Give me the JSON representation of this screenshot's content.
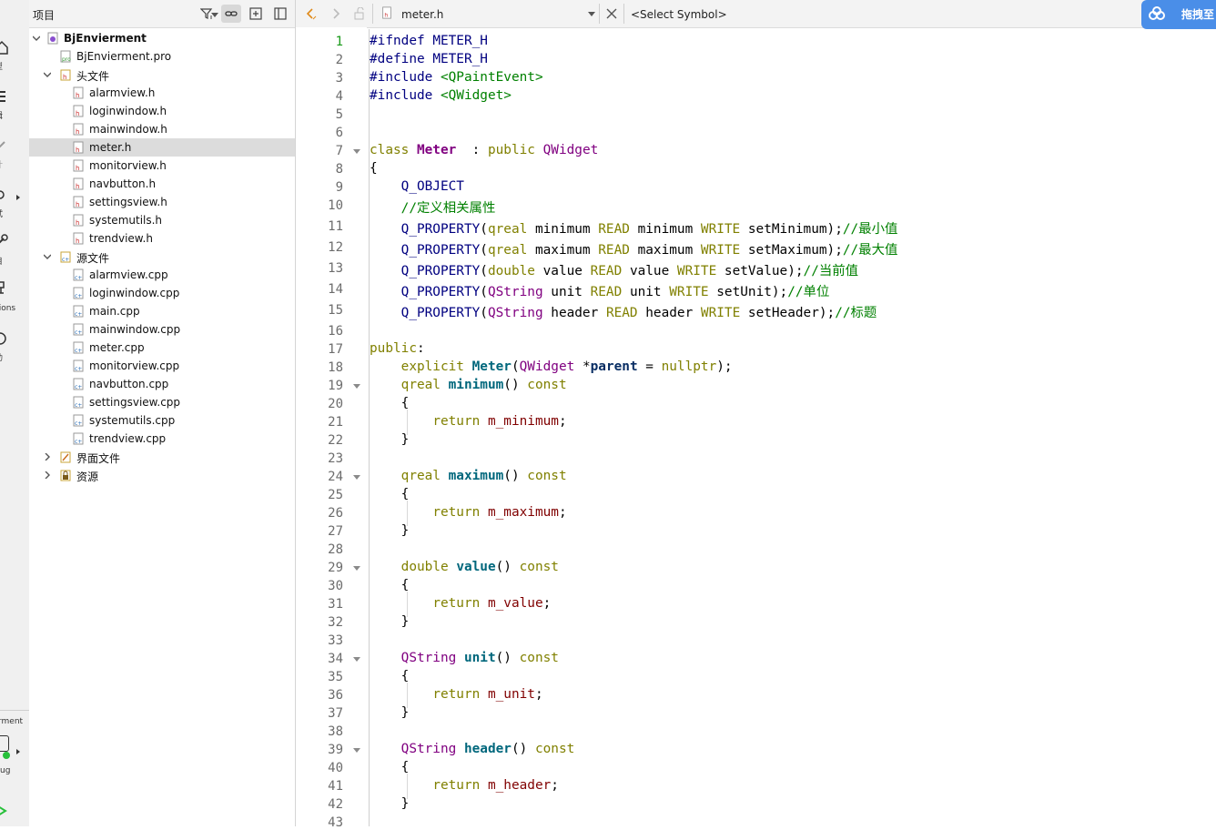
{
  "mode_bar": {
    "items": [
      {
        "label": "型"
      },
      {
        "label": "辑"
      },
      {
        "label": "计"
      },
      {
        "label": "试"
      },
      {
        "label": "目"
      },
      {
        "label": "sions"
      },
      {
        "label": "助"
      }
    ],
    "kit": {
      "project": "rment",
      "config": "ug"
    }
  },
  "project_panel": {
    "view_combo": "项目",
    "tree": {
      "root": "BjEnvierment",
      "pro_file": "BjEnvierment.pro",
      "headers_folder": "头文件",
      "headers": [
        "alarmview.h",
        "loginwindow.h",
        "mainwindow.h",
        "meter.h",
        "monitorview.h",
        "navbutton.h",
        "settingsview.h",
        "systemutils.h",
        "trendview.h"
      ],
      "sources_folder": "源文件",
      "sources": [
        "alarmview.cpp",
        "loginwindow.cpp",
        "main.cpp",
        "mainwindow.cpp",
        "meter.cpp",
        "monitorview.cpp",
        "navbutton.cpp",
        "settingsview.cpp",
        "systemutils.cpp",
        "trendview.cpp"
      ],
      "forms_folder": "界面文件",
      "resources_folder": "资源",
      "selected": "meter.h"
    }
  },
  "editor": {
    "file_name": "meter.h",
    "symbol": "<Select Symbol>",
    "current_line": 1,
    "cloud_label": "拖拽至",
    "line_numbers": [
      "1",
      "2",
      "3",
      "4",
      "5",
      "6",
      "7",
      "8",
      "9",
      "10",
      "11",
      "12",
      "13",
      "14",
      "15",
      "16",
      "17",
      "18",
      "19",
      "20",
      "21",
      "22",
      "23",
      "24",
      "25",
      "26",
      "27",
      "28",
      "29",
      "30",
      "31",
      "32",
      "33",
      "34",
      "35",
      "36",
      "37",
      "38",
      "39",
      "40",
      "41",
      "42",
      "43"
    ],
    "fold_lines": [
      7,
      19,
      24,
      29,
      34,
      39
    ],
    "code": [
      [
        [
          "pp",
          "#ifndef "
        ],
        [
          "mac",
          "METER_H"
        ]
      ],
      [
        [
          "pp",
          "#define "
        ],
        [
          "mac",
          "METER_H"
        ]
      ],
      [
        [
          "pp",
          "#include "
        ],
        [
          "str",
          "<QPaintEvent>"
        ]
      ],
      [
        [
          "pp",
          "#include "
        ],
        [
          "str",
          "<QWidget>"
        ]
      ],
      [],
      [],
      [
        [
          "kw",
          "class "
        ],
        [
          "cls",
          "Meter"
        ],
        [
          "",
          "  : "
        ],
        [
          "kw",
          "public "
        ],
        [
          "ty",
          "QWidget"
        ]
      ],
      [
        [
          "",
          "{"
        ]
      ],
      [
        [
          "",
          "    "
        ],
        [
          "mac",
          "Q_OBJECT"
        ]
      ],
      [
        [
          "",
          "    "
        ],
        [
          "cm",
          "//定义相关属性"
        ]
      ],
      [
        [
          "",
          "    "
        ],
        [
          "mac",
          "Q_PROPERTY"
        ],
        [
          "",
          "("
        ],
        [
          "kw",
          "qreal "
        ],
        [
          "",
          "minimum "
        ],
        [
          "kw",
          "READ "
        ],
        [
          "",
          "minimum "
        ],
        [
          "kw",
          "WRITE "
        ],
        [
          "",
          "setMinimum);"
        ],
        [
          "cm",
          "//最小值"
        ]
      ],
      [
        [
          "",
          "    "
        ],
        [
          "mac",
          "Q_PROPERTY"
        ],
        [
          "",
          "("
        ],
        [
          "kw",
          "qreal "
        ],
        [
          "",
          "maximum "
        ],
        [
          "kw",
          "READ "
        ],
        [
          "",
          "maximum "
        ],
        [
          "kw",
          "WRITE "
        ],
        [
          "",
          "setMaximum);"
        ],
        [
          "cm",
          "//最大值"
        ]
      ],
      [
        [
          "",
          "    "
        ],
        [
          "mac",
          "Q_PROPERTY"
        ],
        [
          "",
          "("
        ],
        [
          "kw",
          "double "
        ],
        [
          "",
          "value "
        ],
        [
          "kw",
          "READ "
        ],
        [
          "",
          "value "
        ],
        [
          "kw",
          "WRITE "
        ],
        [
          "",
          "setValue);"
        ],
        [
          "cm",
          "//当前值"
        ]
      ],
      [
        [
          "",
          "    "
        ],
        [
          "mac",
          "Q_PROPERTY"
        ],
        [
          "",
          "("
        ],
        [
          "ty",
          "QString "
        ],
        [
          "",
          "unit "
        ],
        [
          "kw",
          "READ "
        ],
        [
          "",
          "unit "
        ],
        [
          "kw",
          "WRITE "
        ],
        [
          "",
          "setUnit);"
        ],
        [
          "cm",
          "//单位"
        ]
      ],
      [
        [
          "",
          "    "
        ],
        [
          "mac",
          "Q_PROPERTY"
        ],
        [
          "",
          "("
        ],
        [
          "ty",
          "QString "
        ],
        [
          "",
          "header "
        ],
        [
          "kw",
          "READ "
        ],
        [
          "",
          "header "
        ],
        [
          "kw",
          "WRITE "
        ],
        [
          "",
          "setHeader);"
        ],
        [
          "cm",
          "//标题"
        ]
      ],
      [],
      [
        [
          "kw",
          "public"
        ],
        [
          "",
          ":"
        ]
      ],
      [
        [
          "",
          "    "
        ],
        [
          "kw",
          "explicit "
        ],
        [
          "fn",
          "Meter"
        ],
        [
          "",
          "("
        ],
        [
          "ty",
          "QWidget "
        ],
        [
          "",
          "*"
        ],
        [
          "arg",
          "parent"
        ],
        [
          "",
          " = "
        ],
        [
          "np",
          "nullptr"
        ],
        [
          "",
          ");"
        ]
      ],
      [
        [
          "",
          "    "
        ],
        [
          "kw",
          "qreal "
        ],
        [
          "fn",
          "minimum"
        ],
        [
          "",
          "() "
        ],
        [
          "kw",
          "const"
        ]
      ],
      [
        [
          "",
          "    {"
        ]
      ],
      [
        [
          "",
          "        "
        ],
        [
          "kw",
          "return "
        ],
        [
          "mem",
          "m_minimum"
        ],
        [
          "",
          ";"
        ]
      ],
      [
        [
          "",
          "    }"
        ]
      ],
      [],
      [
        [
          "",
          "    "
        ],
        [
          "kw",
          "qreal "
        ],
        [
          "fn",
          "maximum"
        ],
        [
          "",
          "() "
        ],
        [
          "kw",
          "const"
        ]
      ],
      [
        [
          "",
          "    {"
        ]
      ],
      [
        [
          "",
          "        "
        ],
        [
          "kw",
          "return "
        ],
        [
          "mem",
          "m_maximum"
        ],
        [
          "",
          ";"
        ]
      ],
      [
        [
          "",
          "    }"
        ]
      ],
      [],
      [
        [
          "",
          "    "
        ],
        [
          "kw",
          "double "
        ],
        [
          "fn",
          "value"
        ],
        [
          "",
          "() "
        ],
        [
          "kw",
          "const"
        ]
      ],
      [
        [
          "",
          "    {"
        ]
      ],
      [
        [
          "",
          "        "
        ],
        [
          "kw",
          "return "
        ],
        [
          "mem",
          "m_value"
        ],
        [
          "",
          ";"
        ]
      ],
      [
        [
          "",
          "    }"
        ]
      ],
      [],
      [
        [
          "",
          "    "
        ],
        [
          "ty",
          "QString "
        ],
        [
          "fn",
          "unit"
        ],
        [
          "",
          "() "
        ],
        [
          "kw",
          "const"
        ]
      ],
      [
        [
          "",
          "    {"
        ]
      ],
      [
        [
          "",
          "        "
        ],
        [
          "kw",
          "return "
        ],
        [
          "mem",
          "m_unit"
        ],
        [
          "",
          ";"
        ]
      ],
      [
        [
          "",
          "    }"
        ]
      ],
      [],
      [
        [
          "",
          "    "
        ],
        [
          "ty",
          "QString "
        ],
        [
          "fn",
          "header"
        ],
        [
          "",
          "() "
        ],
        [
          "kw",
          "const"
        ]
      ],
      [
        [
          "",
          "    {"
        ]
      ],
      [
        [
          "",
          "        "
        ],
        [
          "kw",
          "return "
        ],
        [
          "mem",
          "m_header"
        ],
        [
          "",
          ";"
        ]
      ],
      [
        [
          "",
          "    }"
        ]
      ],
      []
    ]
  },
  "colors": {
    "keyword": "#808000",
    "preprocessor": "#000080",
    "string_comment": "#008000",
    "function": "#00677c",
    "type": "#800080",
    "member": "#800000",
    "current_line_number": "#1a9a1a",
    "accent": "#4a8ee8"
  }
}
